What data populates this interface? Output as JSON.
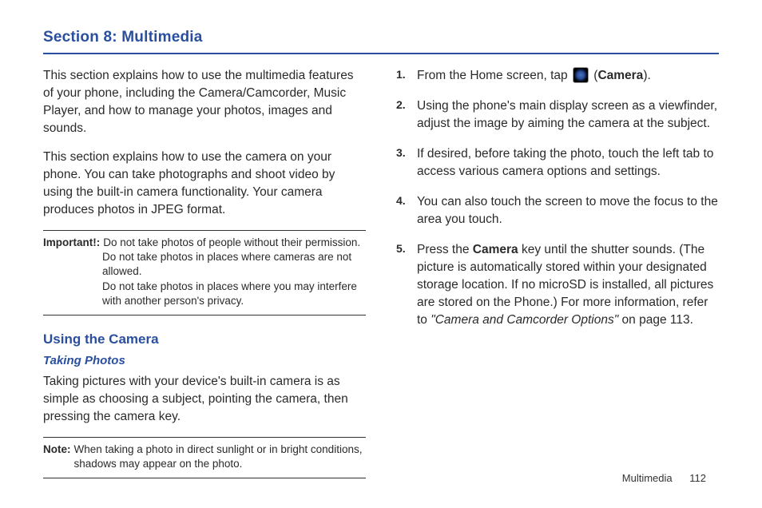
{
  "section": {
    "title": "Section 8: Multimedia"
  },
  "left": {
    "intro1": "This section explains how to use the multimedia features of your phone, including the Camera/Camcorder, Music Player, and how to manage your photos, images and sounds.",
    "intro2": "This section explains how to use the camera on your phone. You can take photographs and shoot video by using the built-in camera functionality. Your camera produces photos in JPEG format.",
    "importantLabel": "Important!:",
    "importantLine1": "Do not take photos of people without their permission.",
    "importantLine2": "Do not take photos in places where cameras are not allowed.",
    "importantLine3": "Do not take photos in places where you may interfere with another person's privacy.",
    "h2": "Using the Camera",
    "h3": "Taking Photos",
    "takingPara": "Taking pictures with your device's built-in camera is as simple as choosing a subject, pointing the camera, then pressing the camera key.",
    "noteLabel": "Note:",
    "noteText": "When taking a photo in direct sunlight or in bright conditions, shadows may appear on the photo."
  },
  "right": {
    "step1a": "From the Home screen, tap ",
    "step1b": " (",
    "step1Bold": "Camera",
    "step1c": ").",
    "step2": "Using the phone's main display screen as a viewfinder, adjust the image by aiming the camera at the subject.",
    "step3": "If desired, before taking the photo, touch the left tab to access various camera options and settings.",
    "step4": "You can also touch the screen to move the focus to the area you touch.",
    "step5a": "Press the ",
    "step5Bold": "Camera",
    "step5b": " key until the shutter sounds. (The picture is automatically stored within your designated storage location. If no microSD is installed, all pictures are stored on the Phone.) For more information, refer to ",
    "step5Italic": "\"Camera and Camcorder Options\"",
    "step5c": "  on page 113."
  },
  "footer": {
    "chapter": "Multimedia",
    "page": "112"
  }
}
